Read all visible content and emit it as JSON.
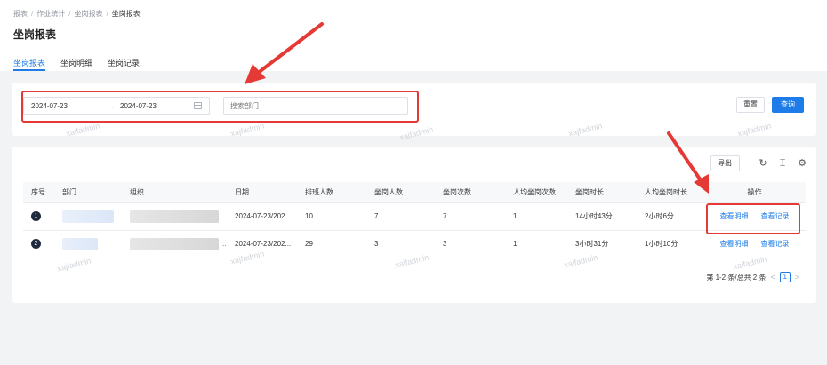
{
  "breadcrumb": [
    "报表",
    "作业统计",
    "坐岗报表",
    "坐岗报表"
  ],
  "page_title": "坐岗报表",
  "tabs": [
    {
      "label": "坐岗报表",
      "active": true
    },
    {
      "label": "坐岗明细",
      "active": false
    },
    {
      "label": "坐岗记录",
      "active": false
    }
  ],
  "filter": {
    "date_start": "2024-07-23",
    "date_arrow": "→",
    "date_end": "2024-07-23",
    "dept_placeholder": "搜索部门",
    "reset_label": "重置",
    "query_label": "查询"
  },
  "toolbar": {
    "export_label": "导出",
    "icons": [
      "refresh-icon",
      "column-height-icon",
      "settings-icon"
    ]
  },
  "table": {
    "headers": [
      "序号",
      "部门",
      "组织",
      "日期",
      "排班人数",
      "坐岗人数",
      "坐岗次数",
      "人均坐岗次数",
      "坐岗时长",
      "人均坐岗时长",
      "操作"
    ],
    "rows": [
      {
        "index": "1",
        "date": "2024-07-23/202...",
        "scheduled": "10",
        "posted": "7",
        "count": "7",
        "avg_count": "1",
        "duration": "14小时43分",
        "avg_duration": "2小时6分",
        "action1": "查看明细",
        "action2": "查看记录"
      },
      {
        "index": "2",
        "date": "2024-07-23/202...",
        "scheduled": "29",
        "posted": "3",
        "count": "3",
        "avg_count": "1",
        "duration": "3小时31分",
        "avg_duration": "1小时10分",
        "action1": "查看明细",
        "action2": "查看记录"
      }
    ]
  },
  "pagination": {
    "summary": "第 1-2 条/总共 2 条",
    "prev": "<",
    "current": "1",
    "next": ">"
  },
  "watermark": "xajfadmin",
  "colors": {
    "accent": "#1e7ce8",
    "annotation": "#e53935"
  }
}
